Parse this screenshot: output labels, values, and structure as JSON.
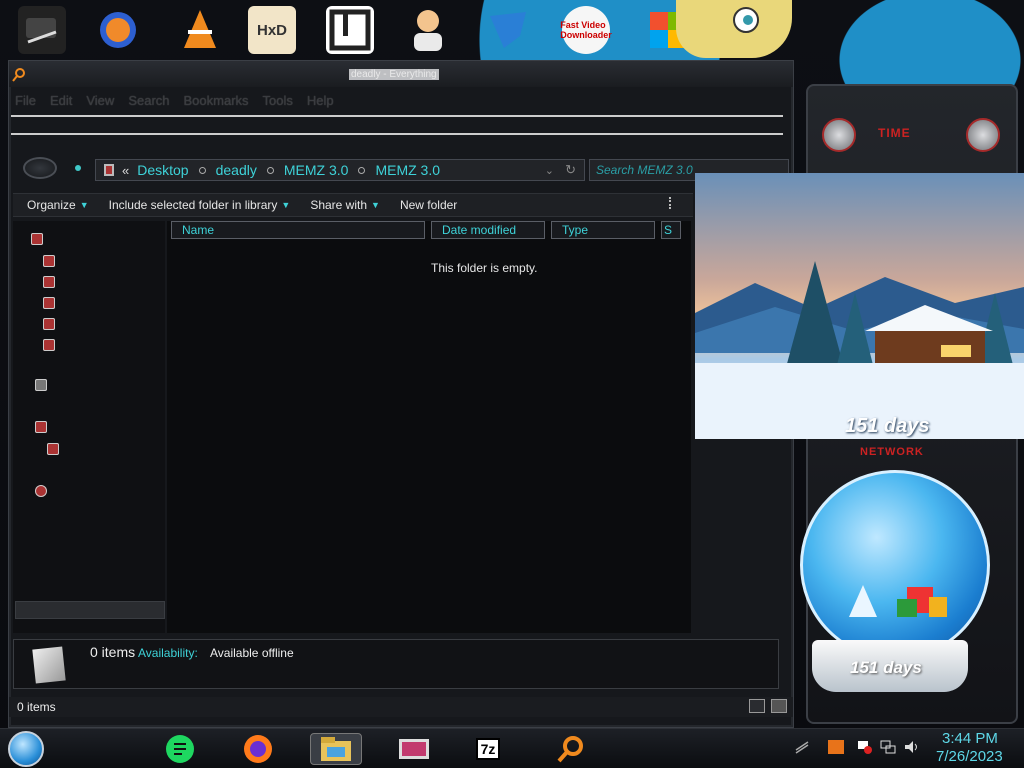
{
  "window": {
    "title": "deadly - Everything",
    "menu": [
      "File",
      "Edit",
      "View",
      "Search",
      "Bookmarks",
      "Tools",
      "Help"
    ]
  },
  "address": {
    "breadcrumbs": [
      "Desktop",
      "deadly",
      "MEMZ 3.0",
      "MEMZ 3.0"
    ],
    "prefix": "«"
  },
  "search": {
    "placeholder": "Search MEMZ 3.0"
  },
  "toolbar": {
    "organize": "Organize",
    "include": "Include selected folder in library",
    "share": "Share with",
    "new_folder": "New folder"
  },
  "columns": [
    "Name",
    "Date modified",
    "Type",
    "S"
  ],
  "file_list": {
    "empty_message": "This folder is empty."
  },
  "details": {
    "count": "0 items",
    "availability_label": "Availability:",
    "availability_value": "Available offline"
  },
  "statusbar": {
    "text": "0 items"
  },
  "gadgets": {
    "winter_days": "151 days",
    "globe_days": "151 days",
    "time_label": "TIME",
    "network_label": "NETWORK"
  },
  "desktop_icons": [
    "HxD",
    "Fast Video Downloader"
  ],
  "taskbar": {
    "apps": [
      "notes-app-icon",
      "firefox-icon",
      "explorer-icon",
      "media-icon",
      "7zip-icon",
      "search-icon"
    ],
    "seven_zip": "7z"
  },
  "clock": {
    "time": "3:44 PM",
    "date": "7/26/2023"
  },
  "colors": {
    "accent": "#3ed2d8",
    "alert": "#cc2222"
  }
}
